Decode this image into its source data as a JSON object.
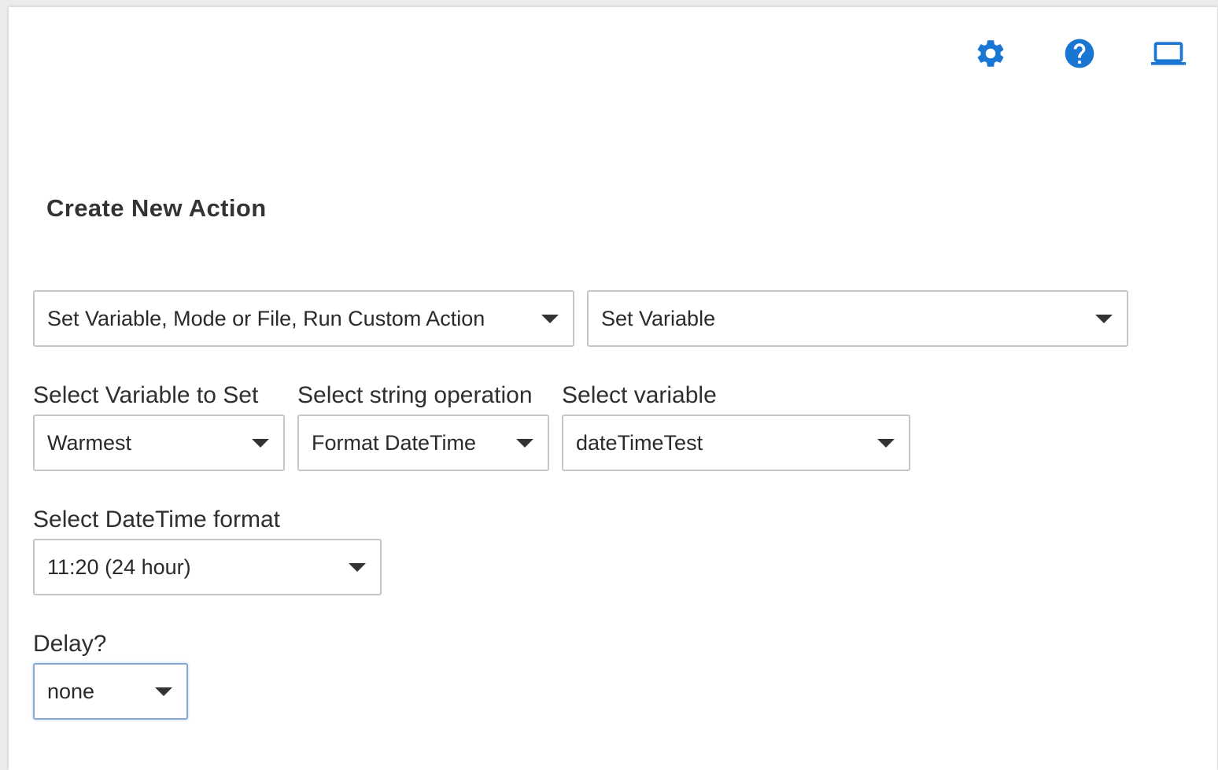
{
  "toolbar": {
    "icons": [
      "gear-icon",
      "help-icon",
      "laptop-icon"
    ],
    "accent_color": "#1976d2"
  },
  "page_title": "Create New Action",
  "action_category": {
    "value": "Set Variable, Mode or File, Run Custom Action"
  },
  "action_type": {
    "value": "Set Variable"
  },
  "variable_to_set": {
    "label": "Select Variable to Set",
    "value": "Warmest"
  },
  "string_operation": {
    "label": "Select string operation",
    "value": "Format DateTime"
  },
  "source_variable": {
    "label": "Select variable",
    "value": "dateTimeTest"
  },
  "datetime_format": {
    "label": "Select DateTime format",
    "value": "11:20 (24 hour)"
  },
  "delay": {
    "label": "Delay?",
    "value": "none"
  }
}
